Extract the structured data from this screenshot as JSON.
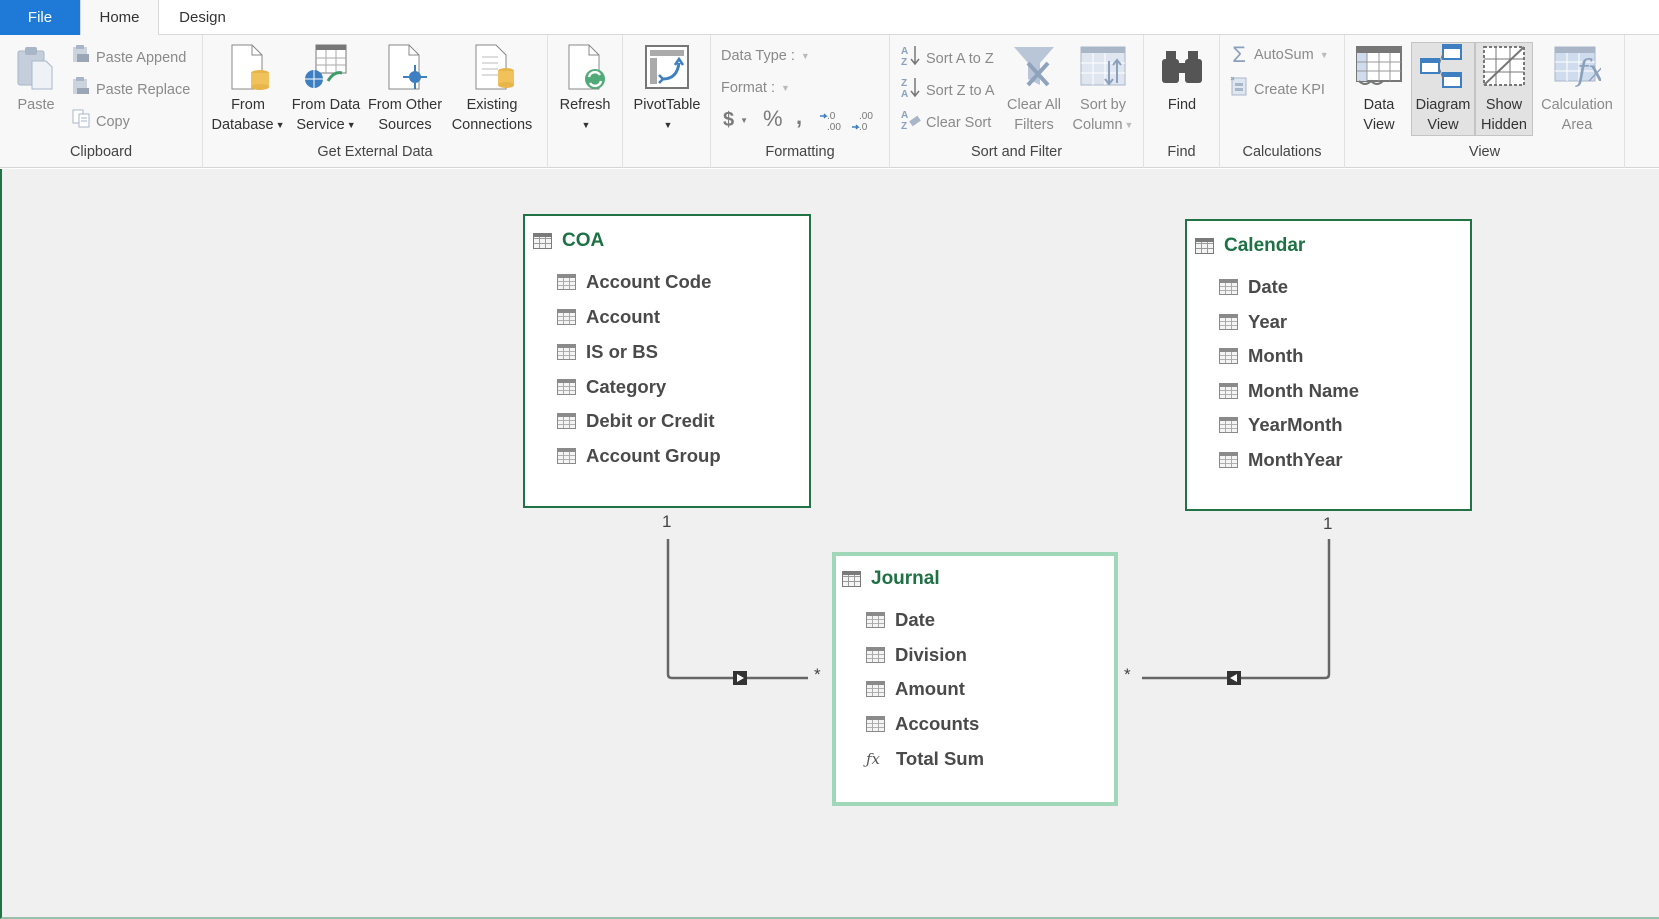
{
  "tabs": [
    {
      "label": "File",
      "active": false
    },
    {
      "label": "Home",
      "active": true
    },
    {
      "label": "Design",
      "active": false
    }
  ],
  "ribbon": {
    "clipboard": {
      "label": "Clipboard",
      "paste": "Paste",
      "paste_append": "Paste Append",
      "paste_replace": "Paste Replace",
      "copy": "Copy"
    },
    "external_data": {
      "label": "Get External Data",
      "from_database": [
        "From",
        "Database"
      ],
      "from_data_service": [
        "From Data",
        "Service"
      ],
      "from_other_sources": [
        "From Other",
        "Sources"
      ],
      "existing_connections": [
        "Existing",
        "Connections"
      ]
    },
    "refresh": {
      "label": "Refresh"
    },
    "pivottable": {
      "label": "PivotTable"
    },
    "formatting": {
      "label": "Formatting",
      "data_type": "Data Type :",
      "format": "Format :",
      "currency": "$",
      "percent": "%",
      "comma": ",",
      "increase_decimal": "+.0 .00",
      "decrease_decimal": ".00 .0"
    },
    "sort_filter": {
      "label": "Sort and Filter",
      "sort_az": "Sort A to Z",
      "sort_za": "Sort Z to A",
      "clear_sort": "Clear Sort",
      "clear_all_filters": [
        "Clear All",
        "Filters"
      ],
      "sort_by_column": [
        "Sort by",
        "Column"
      ]
    },
    "find": {
      "label": "Find",
      "button": "Find"
    },
    "calculations": {
      "label": "Calculations",
      "autosum": "AutoSum",
      "create_kpi": "Create KPI"
    },
    "view": {
      "label": "View",
      "data_view": [
        "Data",
        "View"
      ],
      "diagram_view": [
        "Diagram",
        "View"
      ],
      "show_hidden": [
        "Show",
        "Hidden"
      ],
      "calculation_area": [
        "Calculation",
        "Area"
      ]
    }
  },
  "diagram": {
    "tables": [
      {
        "name": "COA",
        "selected": false,
        "columns": [
          {
            "name": "Account Code",
            "type": "column"
          },
          {
            "name": "Account",
            "type": "column"
          },
          {
            "name": "IS or BS",
            "type": "column"
          },
          {
            "name": "Category",
            "type": "column"
          },
          {
            "name": "Debit or Credit",
            "type": "column"
          },
          {
            "name": "Account Group",
            "type": "column"
          }
        ]
      },
      {
        "name": "Calendar",
        "selected": false,
        "columns": [
          {
            "name": "Date",
            "type": "column"
          },
          {
            "name": "Year",
            "type": "column"
          },
          {
            "name": "Month",
            "type": "column"
          },
          {
            "name": "Month Name",
            "type": "column"
          },
          {
            "name": "YearMonth",
            "type": "column"
          },
          {
            "name": "MonthYear",
            "type": "column"
          }
        ]
      },
      {
        "name": "Journal",
        "selected": true,
        "columns": [
          {
            "name": "Date",
            "type": "column"
          },
          {
            "name": "Division",
            "type": "column"
          },
          {
            "name": "Amount",
            "type": "column"
          },
          {
            "name": "Accounts",
            "type": "column"
          },
          {
            "name": "Total Sum",
            "type": "measure"
          }
        ]
      }
    ],
    "relationships": [
      {
        "from": "Journal",
        "to": "COA",
        "one_label": "1",
        "many_label": "*"
      },
      {
        "from": "Journal",
        "to": "Calendar",
        "one_label": "1",
        "many_label": "*"
      }
    ]
  },
  "colors": {
    "file_tab": "#1e7ad6",
    "table_title": "#1e7145",
    "table_border": "#217346",
    "selected_border": "#9fd7b8",
    "canvas_bg": "#f0f0f0"
  }
}
